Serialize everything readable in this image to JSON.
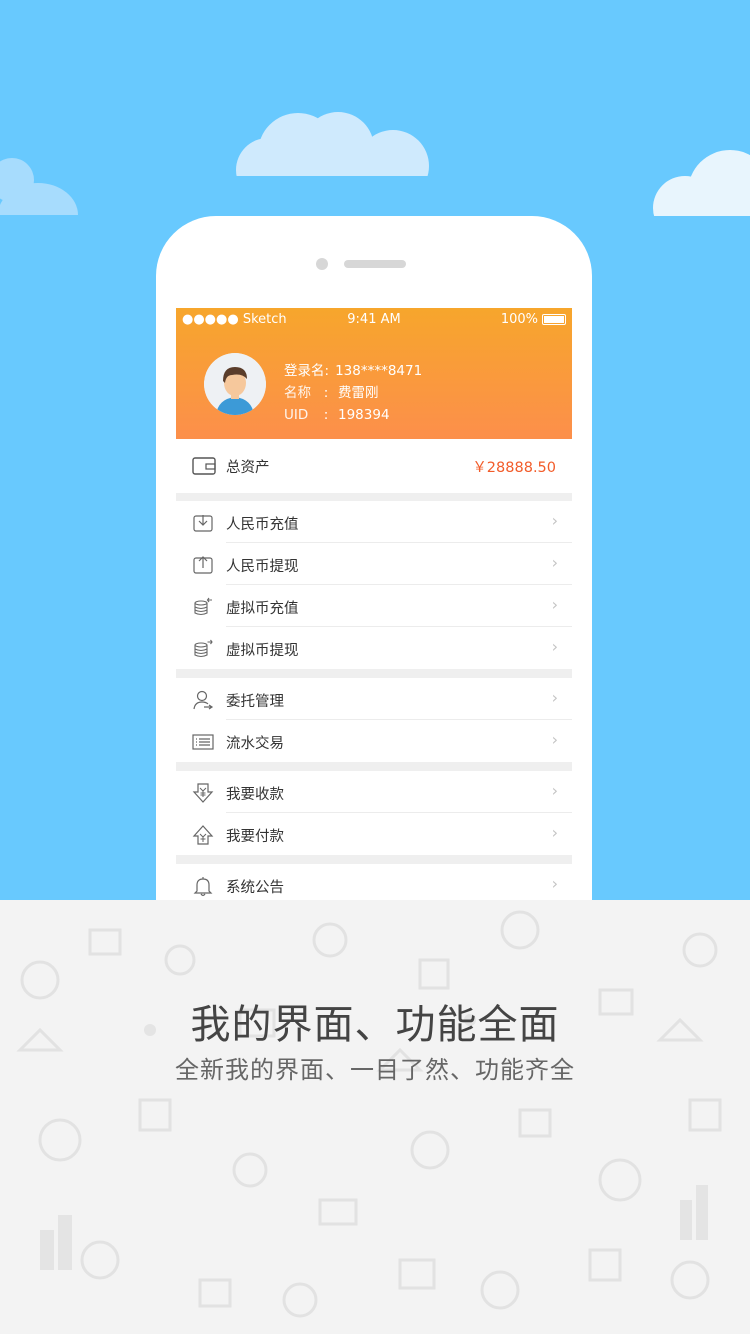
{
  "status_bar": {
    "carrier": "●●●●● Sketch",
    "time": "9:41 AM",
    "battery": "100%"
  },
  "profile": {
    "login_label": "登录名:",
    "login_value": "138****8471",
    "name_label": "名称",
    "name_sep": ":",
    "name_value": "费雷刚",
    "uid_label": "UID",
    "uid_sep": ":",
    "uid_value": "198394"
  },
  "asset": {
    "label": "总资产",
    "value": "￥28888.50"
  },
  "menu": {
    "group1": [
      "人民币充值",
      "人民币提现",
      "虚拟币充值",
      "虚拟币提现"
    ],
    "group2": [
      "委托管理",
      "流水交易"
    ],
    "group3": [
      "我要收款",
      "我要付款"
    ],
    "group4": [
      "系统公告"
    ]
  },
  "promo": {
    "title": "我的界面、功能全面",
    "subtitle": "全新我的界面、一目了然、功能齐全"
  },
  "colors": {
    "sky": "#68c9fe",
    "header_top": "#f7a62c",
    "header_bottom": "#fc8f4b",
    "price": "#f25c2a"
  }
}
